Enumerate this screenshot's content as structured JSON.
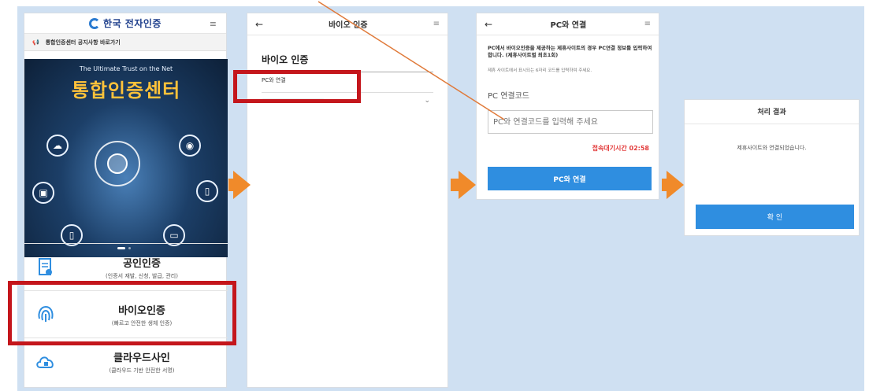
{
  "panel1": {
    "logo": "한국 전자인증",
    "menu_icon": "hamburger-icon",
    "notice": "통합인증센터 공지사항 바로가기",
    "banner_sub": "The Ultimate Trust on the Net",
    "banner_title": "통합인증센터",
    "items": [
      {
        "title": "공인인증",
        "desc": "(인증서 재발, 신청, 발급, 관리)"
      },
      {
        "title": "바이오인증",
        "desc": "(빠르고 안전한 생체 인증)"
      },
      {
        "title": "클라우드사인",
        "desc": "(클라우드 기반 안전한 서명)"
      }
    ]
  },
  "panel2": {
    "header_title": "바이오 인증",
    "page_title": "바이오 인증",
    "selected": "PC와 연결"
  },
  "panel3": {
    "header_title": "PC와 연결",
    "intro": "PC에서 바이오인증을 제공하는 제휴사이트의 경우 PC연결 정보를 입력하여 합니다. (제휴사이트별 최초1회)",
    "intro2": "제휴 사이트에서 표시되는 6자리 코드를 입력하여 주세요.",
    "code_label": "PC 연결코드",
    "code_placeholder": "PC와 연결코드를 입력해 주세요",
    "timer": "접속대기시간 02:58",
    "connect_button": "PC와 연결"
  },
  "panel4": {
    "title": "처리 결과",
    "message": "제휴사이트와 연결되었습니다.",
    "ok_button": "확 인"
  },
  "colors": {
    "accent": "#2f8ee0",
    "highlight": "#c4161c",
    "arrow": "#f08a2a",
    "timer": "#e23a3a"
  }
}
